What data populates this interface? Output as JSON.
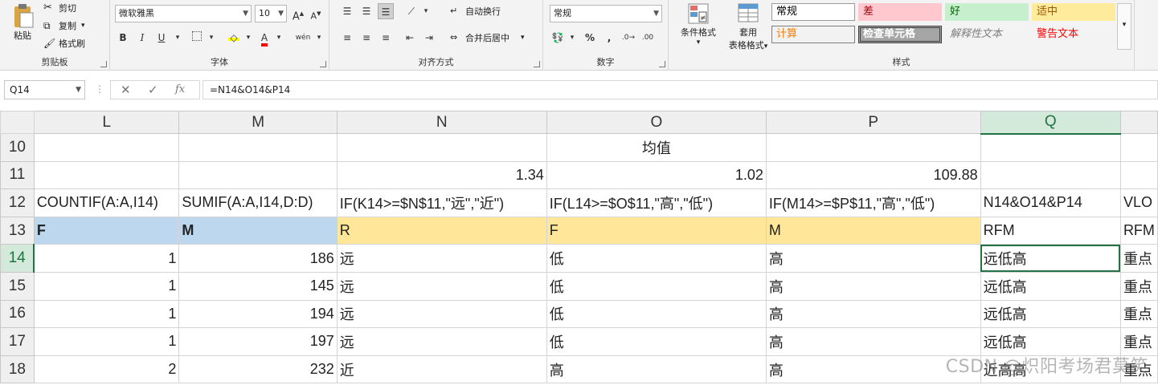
{
  "ribbon": {
    "clipboard": {
      "label": "剪贴板",
      "paste": "粘贴",
      "cut": "剪切",
      "copy": "复制",
      "format_painter": "格式刷"
    },
    "font": {
      "label": "字体",
      "family": "微软雅黑",
      "size": "10",
      "bold": "B",
      "italic": "I",
      "underline": "U",
      "grow": "A",
      "shrink": "A",
      "phonetic": "wén"
    },
    "alignment": {
      "label": "对齐方式",
      "wrap": "自动换行",
      "merge": "合并后居中"
    },
    "number": {
      "label": "数字",
      "format": "常规",
      "percent": "%",
      "comma": ","
    },
    "styles": {
      "label": "样式",
      "conditional": "条件格式",
      "table_format_1": "套用",
      "table_format_2": "表格格式",
      "cells": [
        {
          "text": "常规",
          "bg": "#ffffff",
          "color": "#000000",
          "border": "#9a9a9a"
        },
        {
          "text": "差",
          "bg": "#ffc7ce",
          "color": "#9c0006",
          "border": "transparent"
        },
        {
          "text": "好",
          "bg": "#c6efce",
          "color": "#006100",
          "border": "transparent"
        },
        {
          "text": "适中",
          "bg": "#ffeb9c",
          "color": "#9c5700",
          "border": "transparent"
        },
        {
          "text": "计算",
          "bg": "#f2f2f2",
          "color": "#fa7d00",
          "border": "#7f7f7f"
        },
        {
          "text": "检查单元格",
          "bg": "#a5a5a5",
          "color": "#ffffff",
          "border": "#3f3f3f"
        },
        {
          "text": "解释性文本",
          "bg": "#f3f3f3",
          "color": "#7f7f7f",
          "border": "transparent"
        },
        {
          "text": "警告文本",
          "bg": "#f3f3f3",
          "color": "#ff0000",
          "border": "transparent"
        }
      ]
    }
  },
  "formula_bar": {
    "name_box": "Q14",
    "cancel": "✕",
    "enter": "✓",
    "fx": "fx",
    "formula": "=N14&O14&P14"
  },
  "columns": [
    "L",
    "M",
    "N",
    "O",
    "P",
    "Q",
    ""
  ],
  "rows": [
    {
      "num": "10",
      "cells": [
        "",
        "",
        "",
        "均值",
        "",
        "",
        ""
      ]
    },
    {
      "num": "11",
      "cells": [
        "",
        "",
        "1.34",
        "1.02",
        "109.88",
        "",
        ""
      ]
    },
    {
      "num": "12",
      "cells": [
        "COUNTIF(A:A,I14)",
        "SUMIF(A:A,I14,D:D)",
        "IF(K14>=$N$11,\"远\",\"近\")",
        "IF(L14>=$O$11,\"高\",\"低\")",
        "IF(M14>=$P$11,\"高\",\"低\")",
        "N14&O14&P14",
        "VLO"
      ]
    },
    {
      "num": "13",
      "cells": [
        "F",
        "M",
        "R",
        "F",
        "M",
        "RFM",
        "RFM"
      ]
    },
    {
      "num": "14",
      "cells": [
        "1",
        "186",
        "远",
        "低",
        "高",
        "远低高",
        "重点"
      ]
    },
    {
      "num": "15",
      "cells": [
        "1",
        "145",
        "远",
        "低",
        "高",
        "远低高",
        "重点"
      ]
    },
    {
      "num": "16",
      "cells": [
        "1",
        "194",
        "远",
        "低",
        "高",
        "远低高",
        "重点"
      ]
    },
    {
      "num": "17",
      "cells": [
        "1",
        "197",
        "远",
        "低",
        "高",
        "远低高",
        "重点"
      ]
    },
    {
      "num": "18",
      "cells": [
        "2",
        "232",
        "近",
        "高",
        "高",
        "近高高",
        "重点"
      ]
    }
  ],
  "watermark": "CSDN @炽阳考场君莫笑"
}
